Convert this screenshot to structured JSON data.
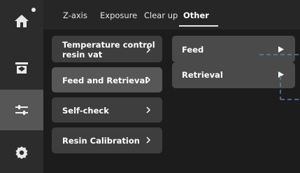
{
  "tabs": [
    {
      "label": "Z-axis"
    },
    {
      "label": "Exposure"
    },
    {
      "label": "Clear up"
    },
    {
      "label": "Other"
    }
  ],
  "active_tab": "Other",
  "sidebar": {
    "items": [
      {
        "icon": "home-icon",
        "has_notification_dot": true
      },
      {
        "icon": "printer-icon"
      },
      {
        "icon": "tools-icon",
        "active": true
      },
      {
        "icon": "gear-icon"
      }
    ]
  },
  "menu": {
    "items": [
      {
        "line1": "Temperature control",
        "line2": "resin vat"
      },
      {
        "label": "Feed and Retrieval",
        "active": true
      },
      {
        "label": "Self-check"
      },
      {
        "label": "Resin Calibration"
      }
    ]
  },
  "submenu": {
    "items": [
      {
        "label": "Feed"
      },
      {
        "label": "Retrieval"
      }
    ]
  },
  "colors": {
    "background": "#1c1c1c",
    "sidebar": "#2c2c2c",
    "sidebar_active": "#565656",
    "button": "#3e3e3e",
    "button_active": "#575757",
    "subbutton": "#4a4a4a",
    "dashed_guide": "#5b7db8"
  }
}
